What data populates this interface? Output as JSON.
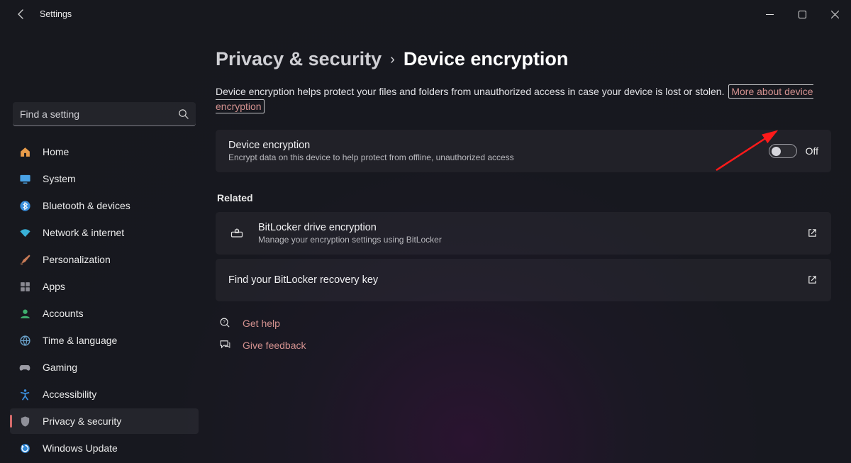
{
  "app": {
    "title": "Settings"
  },
  "search": {
    "placeholder": "Find a setting"
  },
  "nav": {
    "items": [
      {
        "label": "Home"
      },
      {
        "label": "System"
      },
      {
        "label": "Bluetooth & devices"
      },
      {
        "label": "Network & internet"
      },
      {
        "label": "Personalization"
      },
      {
        "label": "Apps"
      },
      {
        "label": "Accounts"
      },
      {
        "label": "Time & language"
      },
      {
        "label": "Gaming"
      },
      {
        "label": "Accessibility"
      },
      {
        "label": "Privacy & security"
      },
      {
        "label": "Windows Update"
      }
    ],
    "active_index": 10
  },
  "breadcrumb": {
    "parent": "Privacy & security",
    "current": "Device encryption"
  },
  "description": "Device encryption helps protect your files and folders from unauthorized access in case your device is lost or stolen.",
  "more_link": "More about device encryption",
  "encryption_card": {
    "title": "Device encryption",
    "subtitle": "Encrypt data on this device to help protect from offline, unauthorized access",
    "state": "Off"
  },
  "related": {
    "heading": "Related",
    "bitlocker": {
      "title": "BitLocker drive encryption",
      "subtitle": "Manage your encryption settings using BitLocker"
    },
    "recovery": {
      "title": "Find your BitLocker recovery key"
    }
  },
  "help": {
    "get_help": "Get help",
    "feedback": "Give feedback"
  }
}
